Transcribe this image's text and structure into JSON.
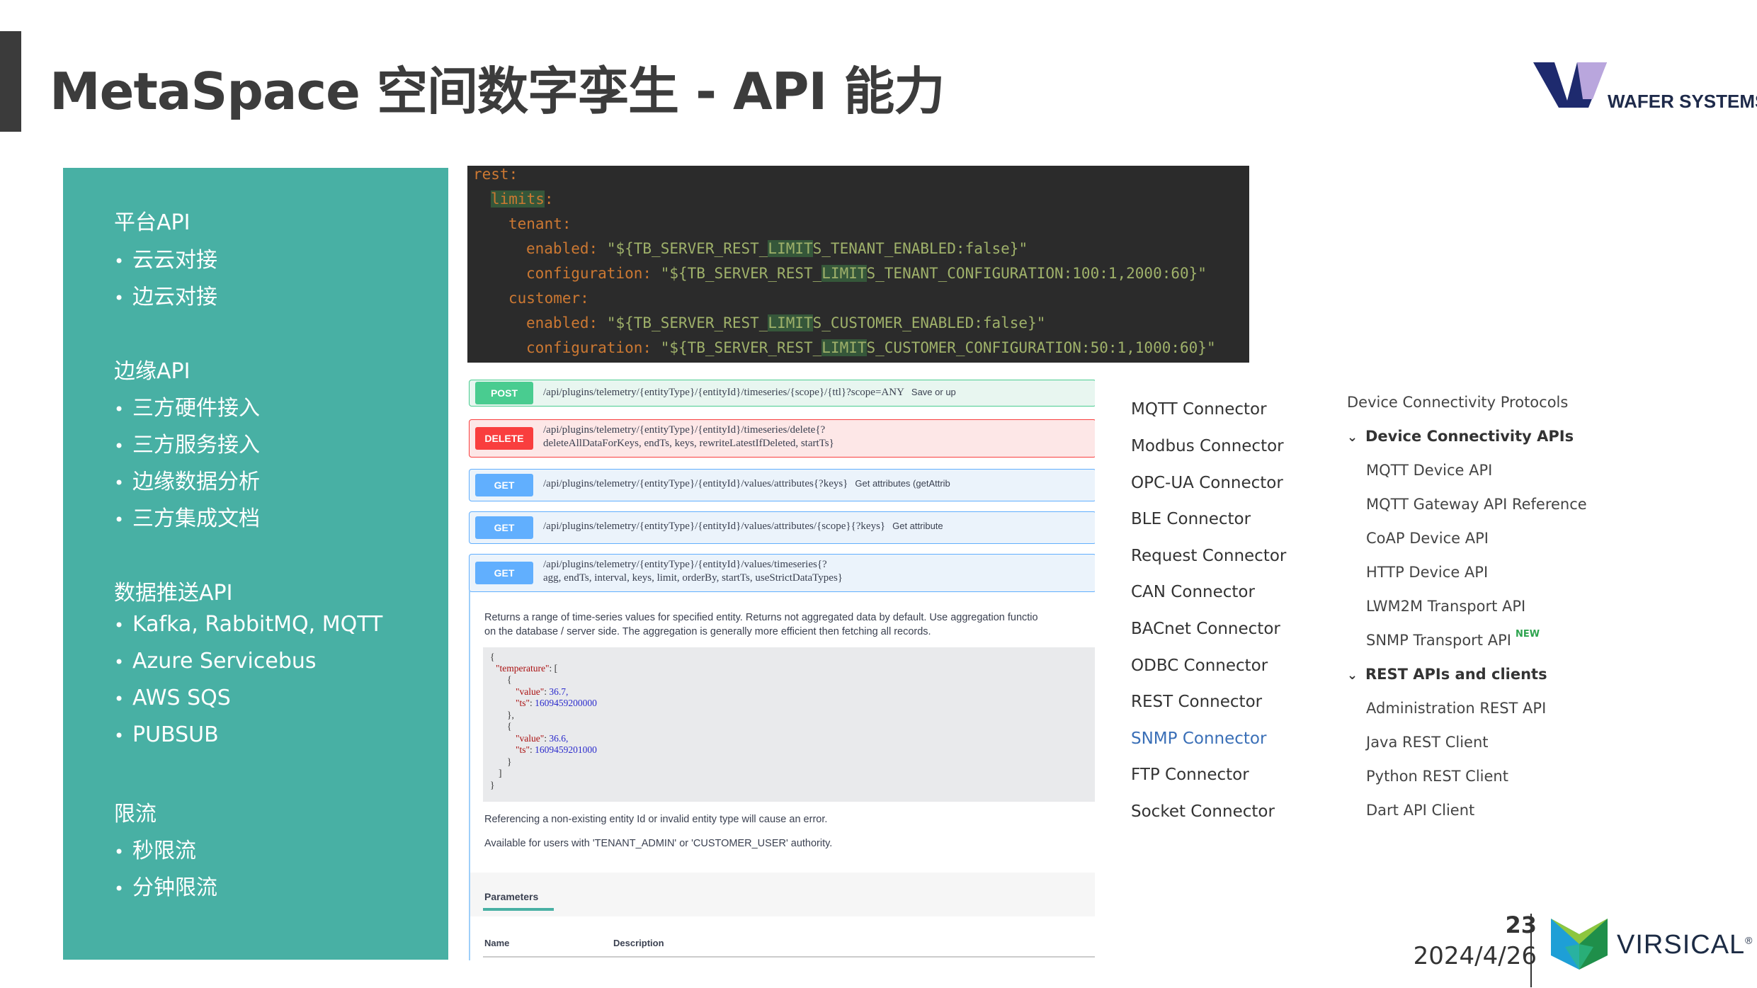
{
  "header": {
    "title": "MetaSpace 空间数字孪生 - API 能力",
    "logo_text": "WAFER SYSTEMS"
  },
  "left_panel": {
    "sections": [
      {
        "title": "平台API",
        "items": [
          "云云对接",
          "边云对接"
        ]
      },
      {
        "title": "边缘API",
        "items": [
          "三方硬件接入",
          "三方服务接入",
          "边缘数据分析",
          "三方集成文档"
        ]
      },
      {
        "title": "数据推送API",
        "items": [
          "Kafka, RabbitMQ, MQTT",
          "Azure Servicebus",
          "AWS SQS",
          "PUBSUB"
        ]
      },
      {
        "title": "限流",
        "items": [
          "秒限流",
          "分钟限流"
        ]
      }
    ],
    "bullet": "•"
  },
  "code": {
    "rest": "rest",
    "limits": "limits",
    "tenant": "tenant",
    "customer": "customer",
    "enabled": "enabled",
    "configuration": "configuration",
    "colon": ":",
    "v_q": "\"",
    "v_prefix": "${TB_SERVER_REST_",
    "v_hl": "LIMIT",
    "t_enabled_rest": "S_TENANT_ENABLED:false}",
    "t_config_rest": "S_TENANT_CONFIGURATION:100:1,2000:60}",
    "c_enabled_rest": "S_CUSTOMER_ENABLED:false}",
    "c_config_rest": "S_CUSTOMER_CONFIGURATION:50:1,1000:60}"
  },
  "swagger": {
    "ops": [
      {
        "method": "POST",
        "path": "/api/plugins/telemetry/{entityType}/{entityId}/timeseries/{scope}/{ttl}?scope=ANY",
        "summary": "Save or up"
      },
      {
        "method": "DELETE",
        "path": "/api/plugins/telemetry/{entityType}/{entityId}/timeseries/delete{?",
        "path2": "deleteAllDataForKeys, endTs, keys, rewriteLatestIfDeleted, startTs}",
        "summary": ""
      },
      {
        "method": "GET",
        "path": "/api/plugins/telemetry/{entityType}/{entityId}/values/attributes{?keys}",
        "summary": "Get attributes (getAttrib"
      },
      {
        "method": "GET",
        "path": "/api/plugins/telemetry/{entityType}/{entityId}/values/attributes/{scope}{?keys}",
        "summary": "Get attribute"
      },
      {
        "method": "GET",
        "path": "/api/plugins/telemetry/{entityType}/{entityId}/values/timeseries{?",
        "path2": "agg, endTs, interval, keys, limit, orderBy, startTs, useStrictDataTypes}",
        "summary": ""
      }
    ],
    "description_1": "Returns a range of time-series values for specified entity. Returns not aggregated data by default. Use aggregation functio",
    "description_2": "on the database / server side. The aggregation is generally more efficient then fetching all records.",
    "example": {
      "open": "{",
      "temperature_key": "\"temperature\"",
      "colon_bracket": ": [",
      "obj_open": "{",
      "value_key": "\"value\"",
      "value_1": "36.7,",
      "ts_key": "\"ts\"",
      "ts_1": "1609459200000",
      "obj_close_comma": "},",
      "value_2": "36.6,",
      "ts_2": "1609459201000",
      "obj_close": "}",
      "bracket_close": "]",
      "close": "}",
      "colon": ": "
    },
    "note_1": "Referencing a non-existing entity Id or invalid entity type will cause an error.",
    "note_2": "Available for users with 'TENANT_ADMIN' or 'CUSTOMER_USER' authority.",
    "parameters_tab": "Parameters",
    "col_name": "Name",
    "col_description": "Description"
  },
  "connectors": {
    "items": [
      "MQTT Connector",
      "Modbus Connector",
      "OPC-UA Connector",
      "BLE Connector",
      "Request Connector",
      "CAN Connector",
      "BACnet Connector",
      "ODBC Connector",
      "REST Connector",
      "SNMP Connector",
      "FTP Connector",
      "Socket Connector"
    ],
    "active_color": "#3a6fb7"
  },
  "api_nav": {
    "top": "Device Connectivity Protocols",
    "group_1": "Device Connectivity APIs",
    "group_1_items": [
      "MQTT Device API",
      "MQTT Gateway API Reference",
      "CoAP Device API",
      "HTTP Device API",
      "LWM2M Transport API",
      "SNMP Transport API"
    ],
    "new_badge": "NEW",
    "group_2": "REST APIs and clients",
    "group_2_items": [
      "Administration REST API",
      "Java REST Client",
      "Python REST Client",
      "Dart API Client"
    ]
  },
  "footer": {
    "page_number": "23",
    "date": "2024/4/26",
    "brand": "VIRSICAL"
  },
  "colors": {
    "panel": "#48b0a4",
    "post": "#49cc90",
    "delete": "#f93e3e",
    "get": "#61affe"
  }
}
